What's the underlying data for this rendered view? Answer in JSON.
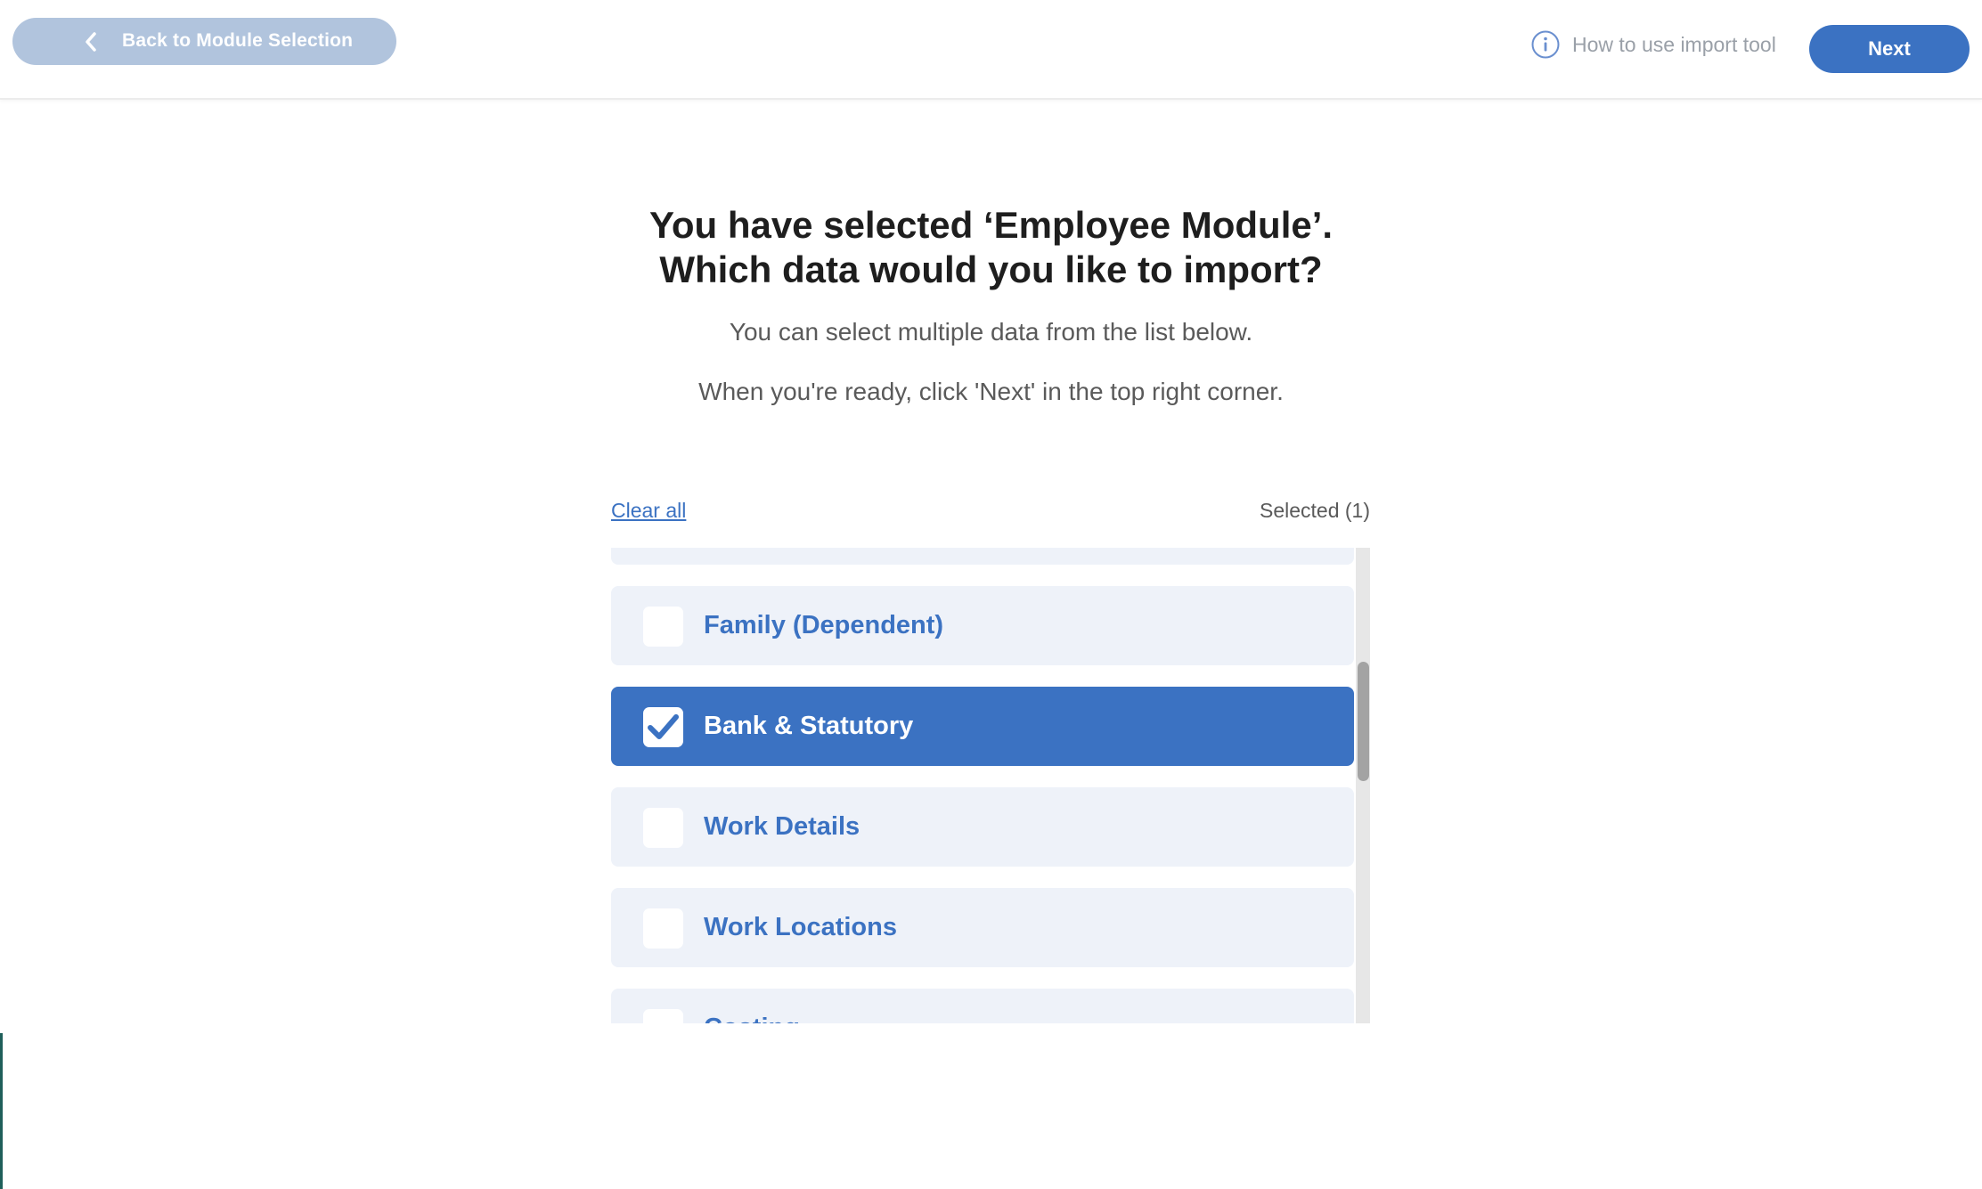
{
  "header": {
    "back_label": "Back to Module Selection",
    "help_label": "How to use import tool",
    "next_label": "Next"
  },
  "main": {
    "title_line1": "You have selected ‘Employee Module’.",
    "title_line2": "Which data would you like to import?",
    "subtitle1": "You can select multiple data from the list below.",
    "subtitle2": "When you're ready, click 'Next' in the top right corner."
  },
  "list": {
    "clear_all_label": "Clear all",
    "selected_label": "Selected (1)",
    "items": [
      {
        "label": "",
        "checked": false
      },
      {
        "label": "Family (Dependent)",
        "checked": false
      },
      {
        "label": "Bank & Statutory",
        "checked": true
      },
      {
        "label": "Work Details",
        "checked": false
      },
      {
        "label": "Work Locations",
        "checked": false
      },
      {
        "label": "Costing",
        "checked": false
      }
    ]
  },
  "colors": {
    "accent": "#3b72c2",
    "back_button_bg": "#b1c4dd",
    "item_bg": "#eef2f9"
  },
  "icons": {
    "back": "chevron-left-icon",
    "help": "info-circle-icon",
    "checkbox_checked": "checkmark-icon"
  }
}
